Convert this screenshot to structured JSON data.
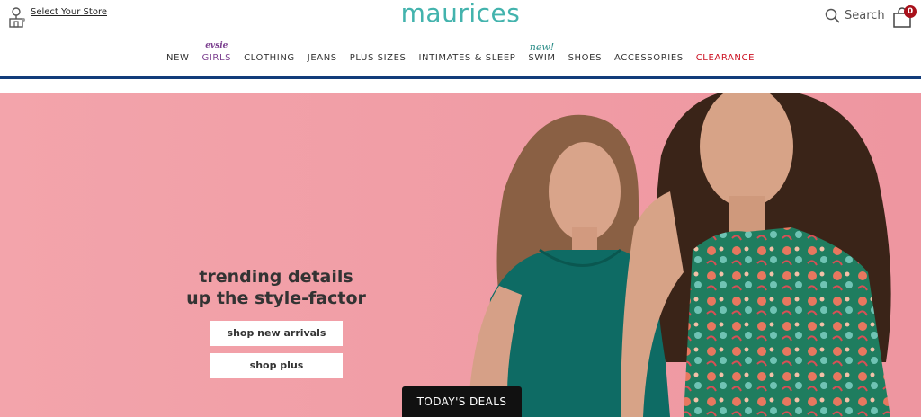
{
  "header": {
    "store_label": "Select Your Store",
    "logo_text": "maurices",
    "search_label": "Search",
    "bag_count": "0"
  },
  "nav": {
    "items": [
      {
        "label": "NEW"
      },
      {
        "label": "GIRLS",
        "tag": "evsie"
      },
      {
        "label": "CLOTHING"
      },
      {
        "label": "JEANS"
      },
      {
        "label": "PLUS SIZES"
      },
      {
        "label": "INTIMATES & SLEEP"
      },
      {
        "label": "SWIM",
        "tag": "new!"
      },
      {
        "label": "SHOES"
      },
      {
        "label": "ACCESSORIES"
      },
      {
        "label": "CLEARANCE"
      }
    ]
  },
  "hero": {
    "headline_line1": "trending details",
    "headline_line2": "up the style-factor",
    "cta_primary": "shop new arrivals",
    "cta_secondary": "shop plus",
    "deals_label": "TODAY'S DEALS"
  },
  "colors": {
    "brand": "#43b3ad",
    "nav_rule": "#123c7a",
    "clearance": "#cc1122",
    "girls": "#7b3f8f",
    "hero_bg": "#f2a0a8",
    "bag_badge": "#a8111b"
  }
}
